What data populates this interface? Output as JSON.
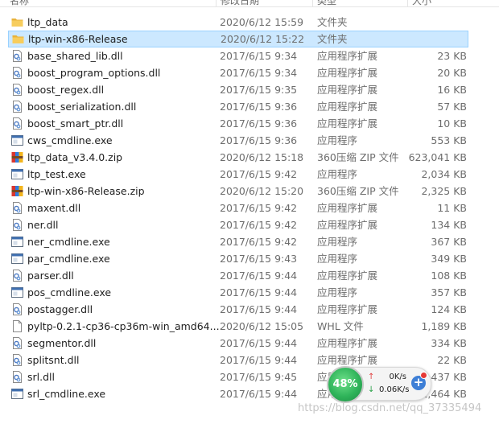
{
  "columns": {
    "name": "名称",
    "date": "修改日期",
    "type": "类型",
    "size": "大小"
  },
  "files": [
    {
      "name": "ltp_data",
      "date": "2020/6/12 15:59",
      "type": "文件夹",
      "size": "",
      "icon": "folder-icon",
      "selected": false
    },
    {
      "name": "ltp-win-x86-Release",
      "date": "2020/6/12 15:22",
      "type": "文件夹",
      "size": "",
      "icon": "folder-icon",
      "selected": true
    },
    {
      "name": "base_shared_lib.dll",
      "date": "2017/6/15 9:34",
      "type": "应用程序扩展",
      "size": "23 KB",
      "icon": "dll-icon",
      "selected": false
    },
    {
      "name": "boost_program_options.dll",
      "date": "2017/6/15 9:34",
      "type": "应用程序扩展",
      "size": "20 KB",
      "icon": "dll-icon",
      "selected": false
    },
    {
      "name": "boost_regex.dll",
      "date": "2017/6/15 9:35",
      "type": "应用程序扩展",
      "size": "16 KB",
      "icon": "dll-icon",
      "selected": false
    },
    {
      "name": "boost_serialization.dll",
      "date": "2017/6/15 9:36",
      "type": "应用程序扩展",
      "size": "57 KB",
      "icon": "dll-icon",
      "selected": false
    },
    {
      "name": "boost_smart_ptr.dll",
      "date": "2017/6/15 9:36",
      "type": "应用程序扩展",
      "size": "10 KB",
      "icon": "dll-icon",
      "selected": false
    },
    {
      "name": "cws_cmdline.exe",
      "date": "2017/6/15 9:36",
      "type": "应用程序",
      "size": "553 KB",
      "icon": "exe-icon",
      "selected": false
    },
    {
      "name": "ltp_data_v3.4.0.zip",
      "date": "2020/6/12 15:18",
      "type": "360压缩 ZIP 文件",
      "size": "623,041 KB",
      "icon": "zip-icon",
      "selected": false
    },
    {
      "name": "ltp_test.exe",
      "date": "2017/6/15 9:42",
      "type": "应用程序",
      "size": "2,034 KB",
      "icon": "exe-icon",
      "selected": false
    },
    {
      "name": "ltp-win-x86-Release.zip",
      "date": "2020/6/12 15:20",
      "type": "360压缩 ZIP 文件",
      "size": "2,325 KB",
      "icon": "zip-icon",
      "selected": false
    },
    {
      "name": "maxent.dll",
      "date": "2017/6/15 9:42",
      "type": "应用程序扩展",
      "size": "11 KB",
      "icon": "dll-icon",
      "selected": false
    },
    {
      "name": "ner.dll",
      "date": "2017/6/15 9:42",
      "type": "应用程序扩展",
      "size": "134 KB",
      "icon": "dll-icon",
      "selected": false
    },
    {
      "name": "ner_cmdline.exe",
      "date": "2017/6/15 9:42",
      "type": "应用程序",
      "size": "367 KB",
      "icon": "exe-icon",
      "selected": false
    },
    {
      "name": "par_cmdline.exe",
      "date": "2017/6/15 9:43",
      "type": "应用程序",
      "size": "349 KB",
      "icon": "exe-icon",
      "selected": false
    },
    {
      "name": "parser.dll",
      "date": "2017/6/15 9:44",
      "type": "应用程序扩展",
      "size": "108 KB",
      "icon": "dll-icon",
      "selected": false
    },
    {
      "name": "pos_cmdline.exe",
      "date": "2017/6/15 9:44",
      "type": "应用程序",
      "size": "357 KB",
      "icon": "exe-icon",
      "selected": false
    },
    {
      "name": "postagger.dll",
      "date": "2017/6/15 9:44",
      "type": "应用程序扩展",
      "size": "124 KB",
      "icon": "dll-icon",
      "selected": false
    },
    {
      "name": "pyltp-0.2.1-cp36-cp36m-win_amd64....",
      "date": "2020/6/12 15:05",
      "type": "WHL 文件",
      "size": "1,189 KB",
      "icon": "file-icon",
      "selected": false
    },
    {
      "name": "segmentor.dll",
      "date": "2017/6/15 9:44",
      "type": "应用程序扩展",
      "size": "334 KB",
      "icon": "dll-icon",
      "selected": false
    },
    {
      "name": "splitsnt.dll",
      "date": "2017/6/15 9:44",
      "type": "应用程序扩展",
      "size": "22 KB",
      "icon": "dll-icon",
      "selected": false
    },
    {
      "name": "srl.dll",
      "date": "2017/6/15 9:45",
      "type": "应用程序扩展",
      "size": "1,437 KB",
      "icon": "dll-icon",
      "selected": false
    },
    {
      "name": "srl_cmdline.exe",
      "date": "2017/6/15 9:44",
      "type": "应用程序",
      "size": "1,464 KB",
      "icon": "exe-icon",
      "selected": false
    }
  ],
  "network_widget": {
    "percent": "48%",
    "upload": "0K/s",
    "download": "0.06K/s",
    "upload_arrow": "↑",
    "download_arrow": "↓",
    "plus": "+"
  },
  "watermark": "https://blog.csdn.net/qq_37335494",
  "colors": {
    "selection": "#cce8ff",
    "selection_border": "#99d1ff",
    "folder": "#f2c14e",
    "gauge": "#2fb45a"
  }
}
